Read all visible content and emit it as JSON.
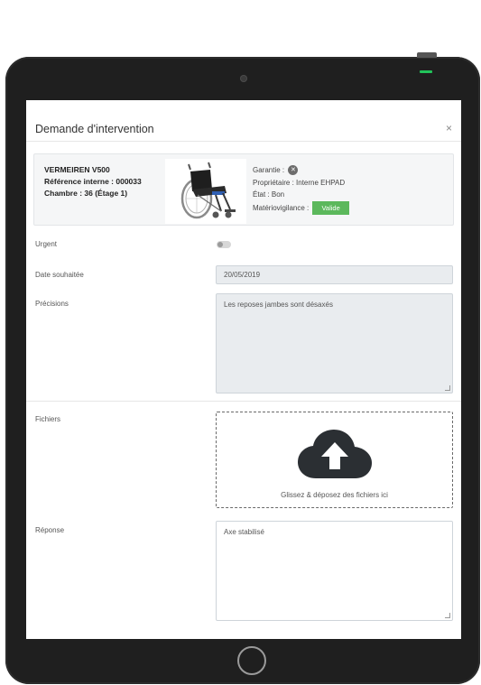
{
  "modal": {
    "title": "Demande d'intervention",
    "close_label": "×"
  },
  "equipment": {
    "name": "VERMEIREN V500",
    "reference": "Référence interne : 000033",
    "chambre": "Chambre : 36 (Étage 1)",
    "garantie_label": "Garantie :",
    "garantie_icon": "x-circle-icon",
    "proprietaire": "Propriétaire : Interne EHPAD",
    "etat": "État : Bon",
    "materiovigilance_label": "Matériovigilance :",
    "materiovigilance_status": "Valide",
    "status_color": "#5cb85c"
  },
  "form": {
    "urgent_label": "Urgent",
    "urgent_on": false,
    "date_label": "Date souhaitée",
    "date_value": "20/05/2019",
    "precisions_label": "Précisions",
    "precisions_value": "Les reposes jambes sont désaxés",
    "fichiers_label": "Fichiers",
    "dropzone_text": "Glissez & déposez des fichiers ici",
    "dropzone_icon": "cloud-upload-icon",
    "reponse_label": "Réponse",
    "reponse_value": "Axe stabilisé"
  },
  "device": {
    "led_color": "#22c35a"
  }
}
